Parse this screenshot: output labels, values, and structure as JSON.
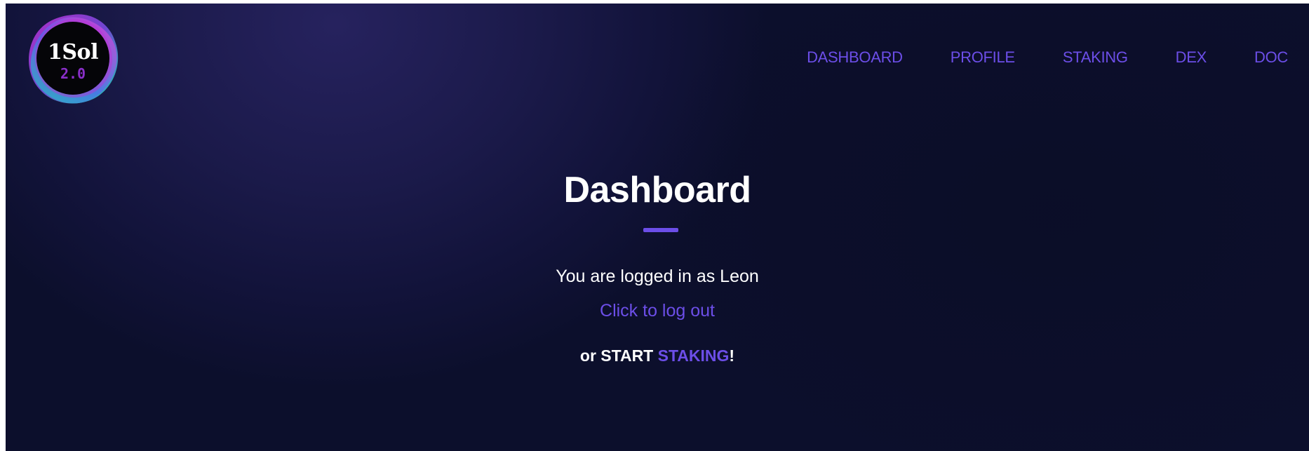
{
  "logo": {
    "name": "1Sol",
    "version": "2.0"
  },
  "nav": {
    "items": [
      {
        "label": "DASHBOARD"
      },
      {
        "label": "PROFILE"
      },
      {
        "label": "STAKING"
      },
      {
        "label": "DEX"
      },
      {
        "label": "DOC"
      }
    ]
  },
  "main": {
    "title": "Dashboard",
    "logged_in_text": "You are logged in as Leon",
    "logout_link": "Click to log out",
    "start_prefix": "or START ",
    "start_link": "STAKING",
    "start_suffix": "!"
  },
  "colors": {
    "accent": "#6c4ee8",
    "background": "#1b1a4a",
    "text": "#ffffff"
  }
}
